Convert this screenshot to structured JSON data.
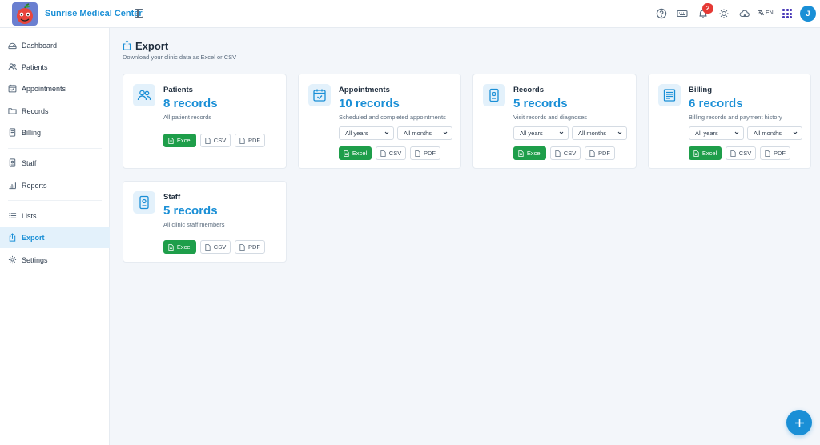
{
  "app": {
    "name": "Sunrise Medical Center"
  },
  "header": {
    "notification_count": "2",
    "language": "EN",
    "user_initial": "J"
  },
  "sidebar": {
    "items": [
      {
        "label": "Dashboard"
      },
      {
        "label": "Patients"
      },
      {
        "label": "Appointments"
      },
      {
        "label": "Records"
      },
      {
        "label": "Billing"
      },
      {
        "label": "Staff"
      },
      {
        "label": "Reports"
      },
      {
        "label": "Lists"
      },
      {
        "label": "Export"
      },
      {
        "label": "Settings"
      }
    ]
  },
  "page": {
    "title": "Export",
    "subtitle": "Download your clinic data as Excel or CSV"
  },
  "cards": [
    {
      "title": "Patients",
      "count": "8 records",
      "description": "All patient records"
    },
    {
      "title": "Appointments",
      "count": "10 records",
      "description": "Scheduled and completed appointments"
    },
    {
      "title": "Records",
      "count": "5 records",
      "description": "Visit records and diagnoses"
    },
    {
      "title": "Billing",
      "count": "6 records",
      "description": "Billing records and payment history"
    },
    {
      "title": "Staff",
      "count": "5 records",
      "description": "All clinic staff members"
    }
  ],
  "filters": {
    "year": "All years",
    "month": "All months"
  },
  "buttons": {
    "excel": "Excel",
    "csv": "CSV",
    "pdf": "PDF"
  },
  "colors": {
    "accent": "#1a8fd6",
    "excel": "#1e9e4a",
    "badge": "#e53935"
  }
}
